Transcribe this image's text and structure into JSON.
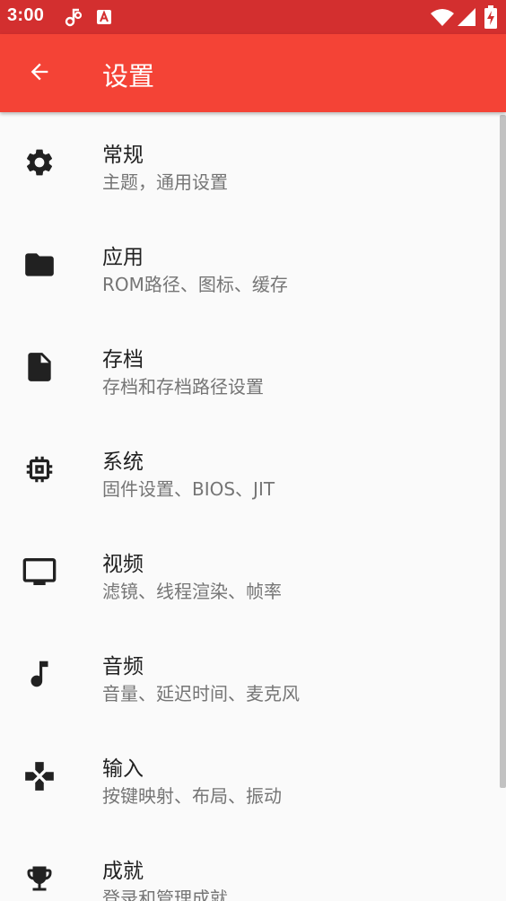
{
  "status_bar": {
    "time": "3:00",
    "notification_icons": [
      "music-note-icon",
      "app-notification-icon"
    ],
    "system_icons": [
      "wifi-icon",
      "cell-signal-icon",
      "battery-charging-icon"
    ]
  },
  "app_bar": {
    "back_icon": "arrow-back-icon",
    "title": "设置"
  },
  "settings": [
    {
      "icon": "gear-icon",
      "title": "常规",
      "subtitle": "主题，通用设置"
    },
    {
      "icon": "folder-icon",
      "title": "应用",
      "subtitle": "ROM路径、图标、缓存"
    },
    {
      "icon": "file-icon",
      "title": "存档",
      "subtitle": "存档和存档路径设置"
    },
    {
      "icon": "chip-icon",
      "title": "系统",
      "subtitle": "固件设置、BIOS、JIT"
    },
    {
      "icon": "tv-icon",
      "title": "视频",
      "subtitle": "滤镜、线程渲染、帧率"
    },
    {
      "icon": "music-note-icon",
      "title": "音频",
      "subtitle": "音量、延迟时间、麦克风"
    },
    {
      "icon": "gamepad-icon",
      "title": "输入",
      "subtitle": "按键映射、布局、振动"
    },
    {
      "icon": "trophy-icon",
      "title": "成就",
      "subtitle": "登录和管理成就"
    }
  ],
  "colors": {
    "status_bar": "#d32f2f",
    "app_bar": "#f44336",
    "background": "#fafafa",
    "title_text": "#212121",
    "subtitle_text": "#757575"
  }
}
